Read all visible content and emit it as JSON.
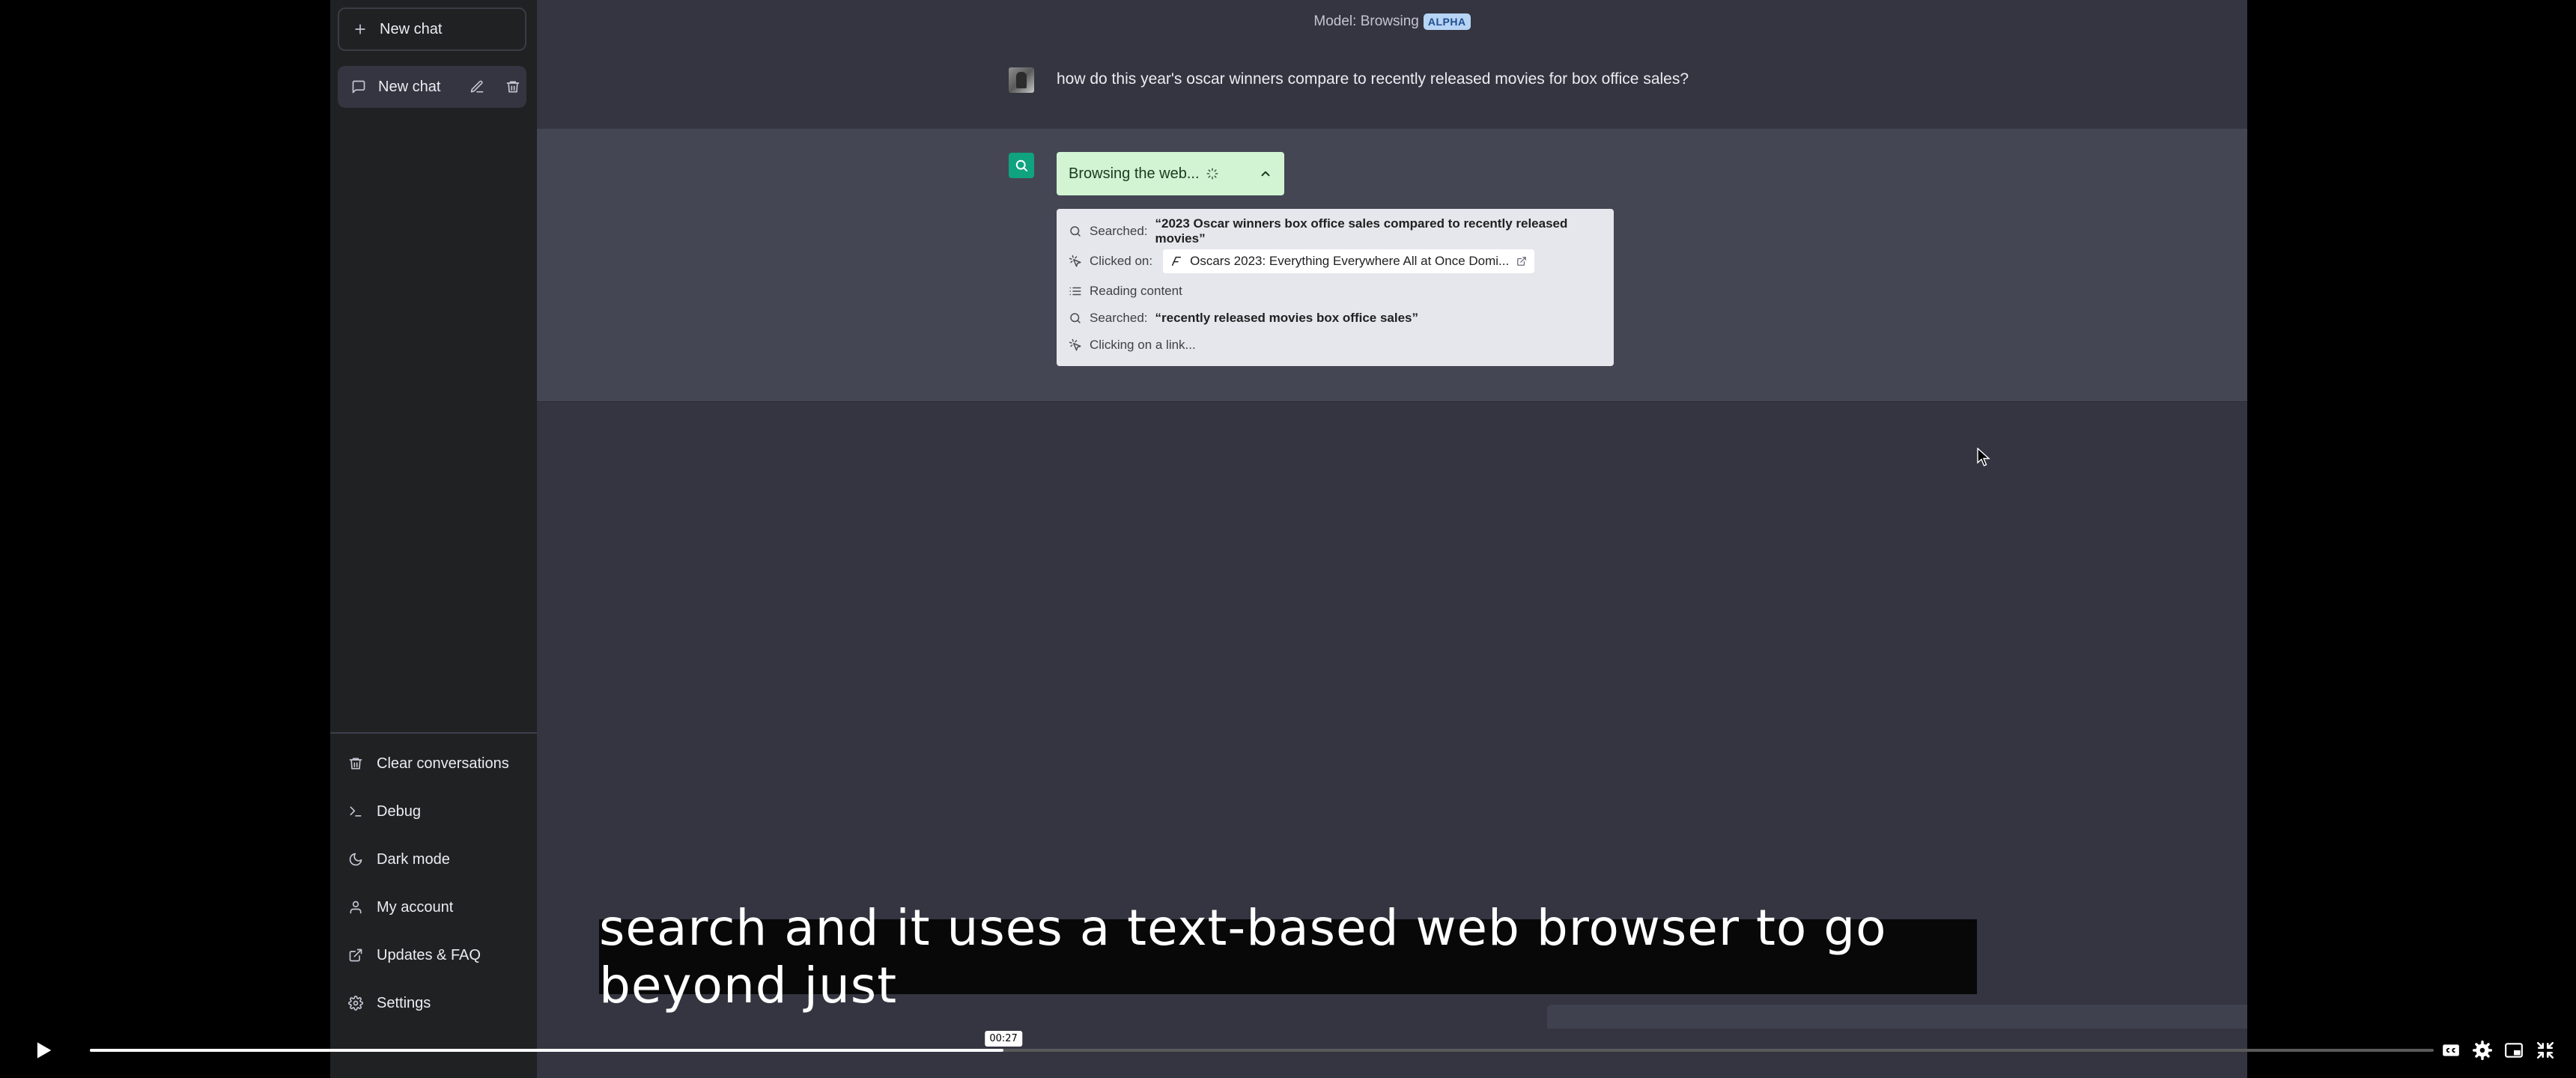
{
  "sidebar": {
    "new_chat_label": "New chat",
    "chats": [
      {
        "label": "New chat"
      }
    ],
    "menu": [
      {
        "label": "Clear conversations",
        "icon": "trash-icon"
      },
      {
        "label": "Debug",
        "icon": "terminal-icon"
      },
      {
        "label": "Dark mode",
        "icon": "moon-icon"
      },
      {
        "label": "My account",
        "icon": "user-icon"
      },
      {
        "label": "Updates & FAQ",
        "icon": "external-link-icon"
      },
      {
        "label": "Settings",
        "icon": "gear-icon"
      }
    ]
  },
  "header": {
    "model_label": "Model: Browsing",
    "badge": "ALPHA"
  },
  "conversation": {
    "user_message": "how do this year's oscar winners compare to recently released movies for box office sales?",
    "browsing": {
      "status": "Browsing the web...",
      "steps": [
        {
          "prefix": "Searched:",
          "query": "“2023 Oscar winners box office sales compared to recently released movies”",
          "icon": "search-icon"
        },
        {
          "prefix": "Clicked on:",
          "link": "Oscars 2023: Everything Everywhere All at Once Domi...",
          "icon": "cursor-click-icon"
        },
        {
          "text": "Reading content",
          "icon": "list-icon"
        },
        {
          "prefix": "Searched:",
          "query": "“recently released movies box office sales”",
          "icon": "search-icon"
        },
        {
          "text": "Clicking on a link...",
          "icon": "cursor-click-icon"
        }
      ]
    }
  },
  "caption": "search and it uses a text-based web browser to go beyond just",
  "video": {
    "current_time": "00:27",
    "progress": 0.3898
  },
  "colors": {
    "sidebar_bg": "#202123",
    "main_bg": "#343541",
    "assistant_bg": "#444654",
    "accent_green": "#10a37f",
    "browse_bg": "#d2f4d3"
  }
}
